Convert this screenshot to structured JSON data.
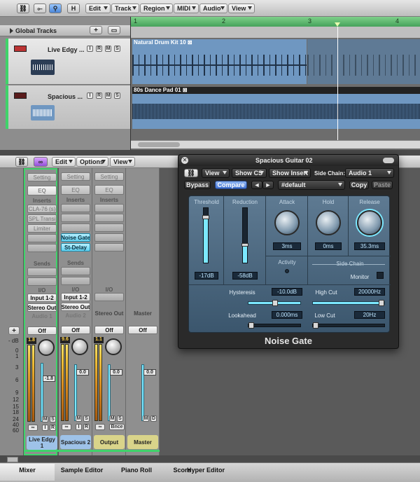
{
  "arrange_toolbar": {
    "h_button": "H",
    "menus": [
      "Edit",
      "Track",
      "Region",
      "MIDI",
      "Audio",
      "View"
    ]
  },
  "global_tracks": {
    "label": "Global Tracks",
    "add": "+",
    "bar_numbers": [
      "1",
      "2",
      "3",
      "4"
    ]
  },
  "tracks": [
    {
      "name": "Live Edgy ...",
      "buttons": [
        "I",
        "R",
        "M",
        "S"
      ],
      "region": "Natural Drum Kit 10"
    },
    {
      "name": "Spacious ...",
      "buttons": [
        "I",
        "R",
        "M",
        "S"
      ],
      "region": "80s Dance Pad 01"
    }
  ],
  "mixer_toolbar": {
    "menus": [
      "Edit",
      "Options",
      "View"
    ]
  },
  "mixer": {
    "db_label": "- dB",
    "scale": [
      "0",
      "1",
      "3",
      "6",
      "9",
      "12",
      "15",
      "18",
      "24",
      "40",
      "60"
    ],
    "add_button": "+",
    "strips": [
      {
        "setting": "Setting",
        "eq": "EQ",
        "inserts_label": "Inserts",
        "inserts": [
          "CLA-76 (s)",
          "SPL Transi",
          "Limiter"
        ],
        "sends_label": "Sends",
        "io_label": "I/O",
        "input": "Input 1-2",
        "output": "Stereo Out",
        "automation_label": "Audio 1",
        "automation": "Off",
        "peak": "1.8",
        "volume": "-1.8",
        "buttons": [
          "M",
          "S",
          "I",
          "R"
        ],
        "name": "Live Edgy 1",
        "name_color": "#9ec2e8"
      },
      {
        "setting": "Setting",
        "eq": "EQ",
        "inserts_label": "Inserts",
        "inserts": [
          "Noise Gate",
          "St-Delay"
        ],
        "sends_label": "Sends",
        "io_label": "I/O",
        "input": "Input 1-2",
        "output": "Stereo Out",
        "automation_label": "Audio 2",
        "automation": "Off",
        "peak": "9.6",
        "volume": "0.0",
        "buttons": [
          "M",
          "S",
          "I",
          "R"
        ],
        "name": "Spacious 2",
        "name_color": "#9ec2e8"
      },
      {
        "setting": "Setting",
        "eq": "EQ",
        "inserts_label": "Inserts",
        "io_label": "I/O",
        "output_label": "Stereo Out",
        "automation": "Off",
        "peak": "1.1",
        "volume": "0.0",
        "buttons": [
          "M",
          "S",
          "Bnce"
        ],
        "name": "Output",
        "name_color": "#d9d48a"
      },
      {
        "output_label": "Master",
        "automation": "Off",
        "volume": "0.0",
        "buttons": [
          "M",
          "D"
        ],
        "name": "Master",
        "name_color": "#d9d48a"
      }
    ]
  },
  "plugin": {
    "title": "Spacious Guitar 02",
    "row1": {
      "view": "View",
      "show_cs": "Show CS",
      "show_insert": "Show Insert",
      "side_chain_label": "Side Chain:",
      "side_chain": "Audio 1"
    },
    "row2": {
      "bypass": "Bypass",
      "compare": "Compare",
      "prev": "◄",
      "next": "►",
      "preset": "#default",
      "copy": "Copy",
      "paste": "Paste"
    },
    "params": {
      "threshold": {
        "label": "Threshold",
        "value": "-17dB"
      },
      "reduction": {
        "label": "Reduction",
        "value": "-58dB"
      },
      "attack": {
        "label": "Attack",
        "value": "3ms"
      },
      "hold": {
        "label": "Hold",
        "value": "0ms"
      },
      "release": {
        "label": "Release",
        "value": "35.3ms"
      },
      "activity": {
        "label": "Activity"
      },
      "side_chain": {
        "label": "Side Chain",
        "monitor": "Monitor"
      },
      "hysteresis": {
        "label": "Hysteresis",
        "value": "-10.0dB"
      },
      "lookahead": {
        "label": "Lookahead",
        "value": "0.000ms"
      },
      "high_cut": {
        "label": "High Cut",
        "value": "20000Hz"
      },
      "low_cut": {
        "label": "Low Cut",
        "value": "20Hz"
      }
    },
    "name": "Noise Gate"
  },
  "bottom_tabs": [
    "Mixer",
    "Sample Editor",
    "Piano Roll",
    "Score",
    "Hyper Editor"
  ],
  "colors": {
    "accent": "#7ce8ff",
    "green": "#3fd36a",
    "region_blue": "#6f97c1"
  }
}
